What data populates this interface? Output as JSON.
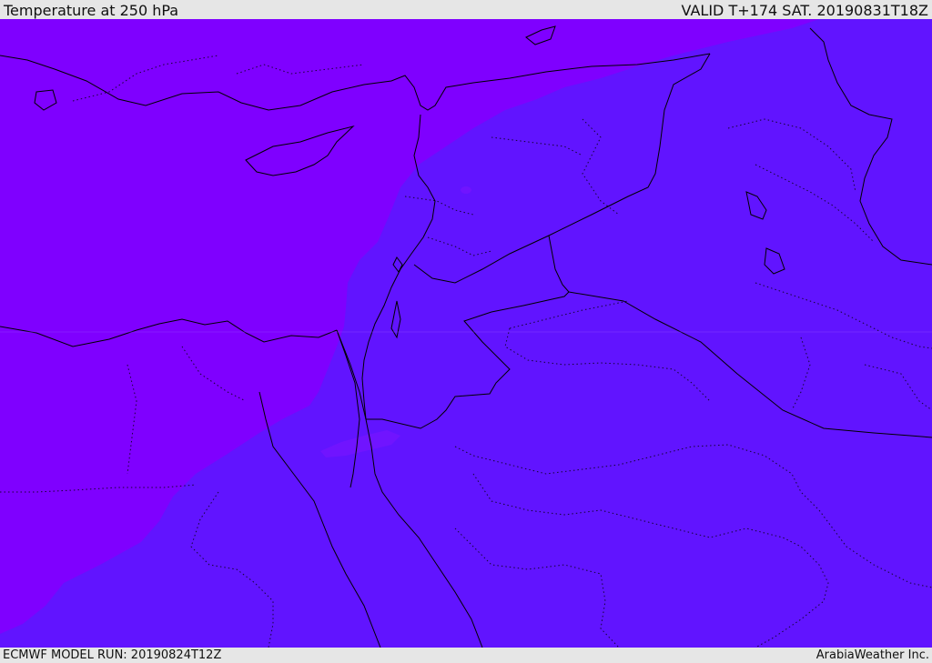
{
  "header": {
    "title": "Temperature at 250 hPa",
    "valid": "VALID T+174 SAT. 20190831T18Z"
  },
  "footer": {
    "model_run": "ECMWF MODEL RUN: 20190824T12Z",
    "credit": "ArabiaWeather Inc."
  },
  "map": {
    "colors": {
      "cold_zone": "#7f00ff",
      "warm_zone": "#6114ff",
      "patch": "#7014ff",
      "coastline": "#000000",
      "borders": "#000000"
    }
  }
}
